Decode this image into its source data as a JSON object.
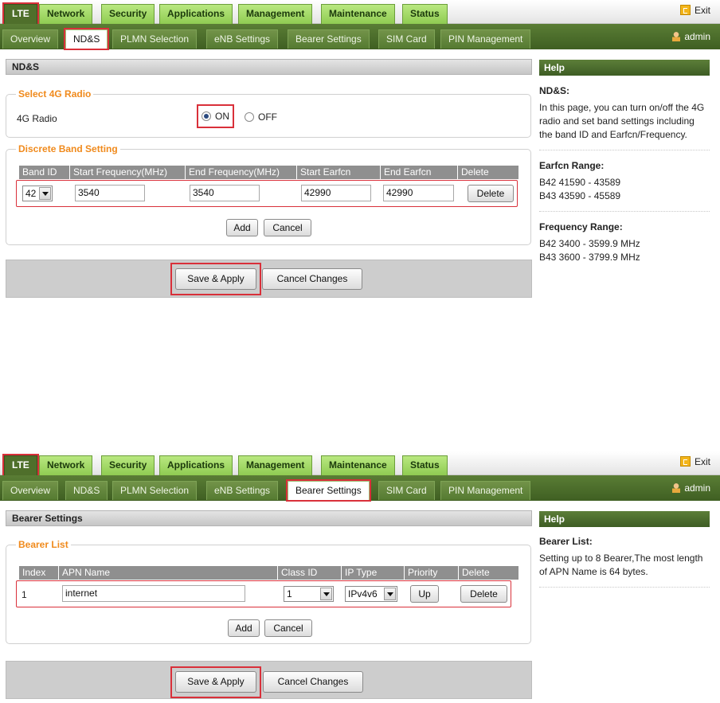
{
  "top_tabs": [
    "LTE",
    "Network",
    "Security",
    "Applications",
    "Management",
    "Maintenance",
    "Status"
  ],
  "exit_label": "Exit",
  "sub_tabs": [
    "Overview",
    "ND&S",
    "PLMN Selection",
    "eNB Settings",
    "Bearer Settings",
    "SIM Card",
    "PIN Management"
  ],
  "admin_label": "admin",
  "help_title": "Help",
  "screen1": {
    "section_title": "ND&S",
    "radio_legend": "Select 4G Radio",
    "radio_label": "4G Radio",
    "radio_on": "ON",
    "radio_off": "OFF",
    "band_legend": "Discrete Band Setting",
    "headers": [
      "Band ID",
      "Start Frequency(MHz)",
      "End Frequency(MHz)",
      "Start Earfcn",
      "End Earfcn",
      "Delete"
    ],
    "row": {
      "band_id": "42",
      "start_freq": "3540",
      "end_freq": "3540",
      "start_earfcn": "42990",
      "end_earfcn": "42990",
      "delete": "Delete"
    },
    "add": "Add",
    "cancel": "Cancel",
    "save_apply": "Save & Apply",
    "cancel_changes": "Cancel Changes",
    "help": {
      "h1": "ND&S:",
      "p1": "In this page, you can turn on/off the 4G radio and set band settings including the band ID and Earfcn/Frequency.",
      "h2": "Earfcn Range:",
      "p2a": "B42 41590 - 43589",
      "p2b": "B43 43590 - 45589",
      "h3": "Frequency Range:",
      "p3a": "B42 3400 - 3599.9 MHz",
      "p3b": "B43 3600 - 3799.9 MHz"
    }
  },
  "screen2": {
    "section_title": "Bearer Settings",
    "legend": "Bearer List",
    "headers": [
      "Index",
      "APN Name",
      "Class ID",
      "IP Type",
      "Priority",
      "Delete"
    ],
    "row": {
      "index": "1",
      "apn": "internet",
      "class_id": "1",
      "ip_type": "IPv4v6",
      "up": "Up",
      "delete": "Delete"
    },
    "add": "Add",
    "cancel": "Cancel",
    "save_apply": "Save & Apply",
    "cancel_changes": "Cancel Changes",
    "help": {
      "h1": "Bearer List:",
      "p1": "Setting up to 8 Bearer,The most length of APN Name is 64 bytes."
    }
  }
}
